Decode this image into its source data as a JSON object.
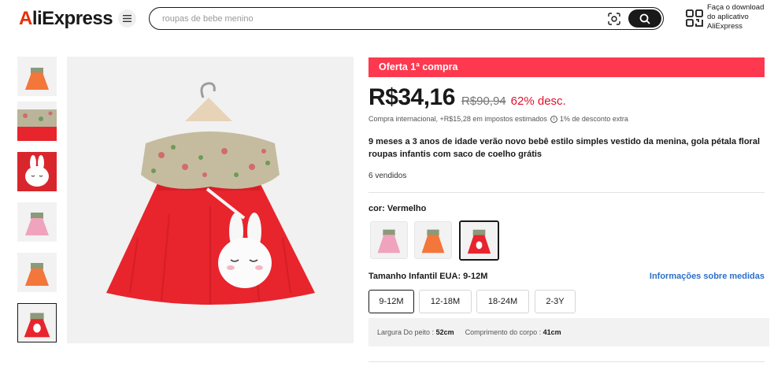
{
  "header": {
    "logo": "AliExpress",
    "logo_a": "A",
    "logo_rest": "liExpress",
    "menu_icon": "hamburger-icon",
    "search_placeholder": "roupas de bebe menino",
    "search_value": "",
    "camera_icon": "camera-search-icon",
    "search_icon": "search-icon",
    "qr_icon": "qr-code-icon",
    "app_download_text": "Faça o download do aplicativo AliExpress"
  },
  "gallery": {
    "thumbnails": [
      {
        "variant": "orange",
        "selected": false
      },
      {
        "variant": "collar-closeup",
        "selected": false
      },
      {
        "variant": "bunny-bag",
        "selected": false
      },
      {
        "variant": "pink",
        "selected": false
      },
      {
        "variant": "orange",
        "selected": false
      },
      {
        "variant": "red",
        "selected": true
      }
    ],
    "main_image": "red-dress-with-bunny-bag"
  },
  "product": {
    "promo_banner": "Oferta 1ª compra",
    "price": "R$34,16",
    "original_price": "R$90,94",
    "discount": "62% desc.",
    "tax_text": "Compra internacional, +R$15,28 em impostos estimados",
    "tax_discount_text": "1% de desconto extra",
    "title": "9 meses a 3 anos de idade verão novo bebê estilo simples vestido da menina, gola pétala floral roupas infantis com saco de coelho grátis",
    "sold": "6 vendidos",
    "color_label": "cor: Vermelho",
    "colors": [
      {
        "name": "pink",
        "selected": false
      },
      {
        "name": "orange",
        "selected": false
      },
      {
        "name": "red",
        "selected": true
      }
    ],
    "size_label": "Tamanho Infantil EUA: 9-12M",
    "size_info_link": "Informações sobre medidas",
    "sizes": [
      {
        "label": "9-12M",
        "selected": true
      },
      {
        "label": "12-18M",
        "selected": false
      },
      {
        "label": "18-24M",
        "selected": false
      },
      {
        "label": "2-3Y",
        "selected": false
      }
    ],
    "measurements": {
      "chest_label": "Largura Do peito :",
      "chest_value": "52cm",
      "length_label": "Comprimento do corpo :",
      "length_value": "41cm"
    }
  },
  "colors": {
    "brand_red": "#e62e04",
    "promo_bg": "#fd384f",
    "discount_red": "#e0102f",
    "link_blue": "#2c6fcb",
    "dress_red": "#e8242d",
    "dress_orange": "#f3763a",
    "dress_pink": "#f0a3bd"
  }
}
